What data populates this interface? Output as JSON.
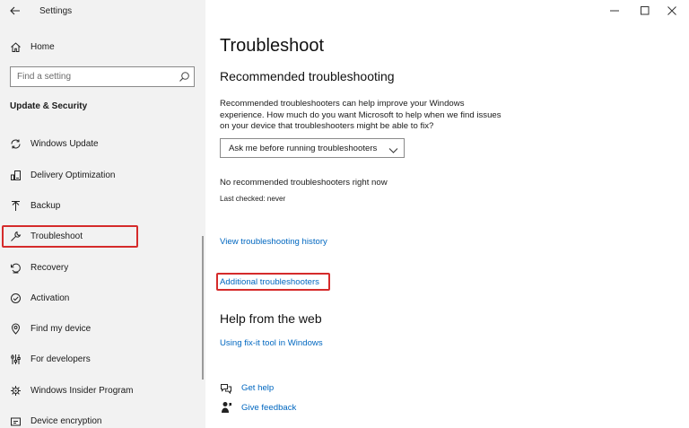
{
  "app": {
    "title": "Settings"
  },
  "sidebar": {
    "home_label": "Home",
    "search_placeholder": "Find a setting",
    "section_title": "Update & Security",
    "items": [
      {
        "label": "Windows Update",
        "icon": "sync-icon"
      },
      {
        "label": "Delivery Optimization",
        "icon": "delivery-optimization-icon"
      },
      {
        "label": "Backup",
        "icon": "backup-arrow-icon"
      },
      {
        "label": "Troubleshoot",
        "icon": "wrench-icon",
        "selected": true
      },
      {
        "label": "Recovery",
        "icon": "recovery-icon"
      },
      {
        "label": "Activation",
        "icon": "check-circle-icon"
      },
      {
        "label": "Find my device",
        "icon": "find-device-icon"
      },
      {
        "label": "For developers",
        "icon": "developer-sliders-icon"
      },
      {
        "label": "Windows Insider Program",
        "icon": "insider-icon"
      },
      {
        "label": "Device encryption",
        "icon": "encryption-icon"
      }
    ]
  },
  "main": {
    "title": "Troubleshoot",
    "recommended_title": "Recommended troubleshooting",
    "description": "Recommended troubleshooters can help improve your Windows experience. How much do you want Microsoft to help when we find issues on your device that troubleshooters might be able to fix?",
    "dropdown_value": "Ask me before running troubleshooters",
    "status_text": "No recommended troubleshooters right now",
    "last_checked": "Last checked: never",
    "history_link": "View troubleshooting history",
    "additional_link": "Additional troubleshooters",
    "help_title": "Help from the web",
    "fixit_link": "Using fix-it tool in Windows",
    "get_help": "Get help",
    "give_feedback": "Give feedback"
  },
  "colors": {
    "link": "#0067c0",
    "highlight": "#d52b2b",
    "sidebar_bg": "#f2f2f2"
  }
}
